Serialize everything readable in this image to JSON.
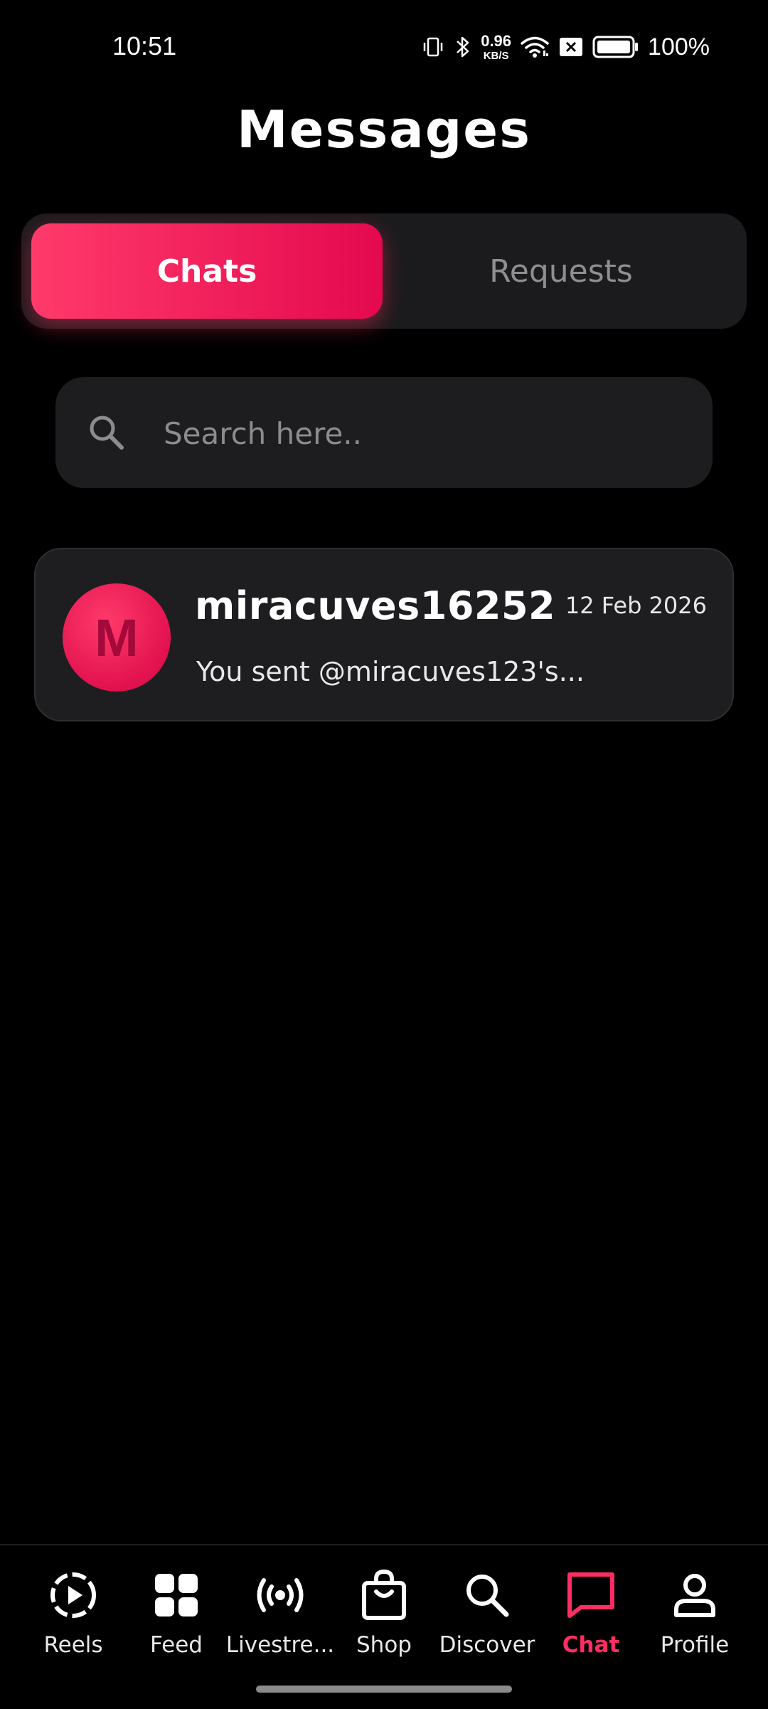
{
  "status_bar": {
    "time": "10:51",
    "net_speed_value": "0.96",
    "net_speed_unit": "KB/S",
    "battery_percent": "100%"
  },
  "header": {
    "title": "Messages"
  },
  "tabs": [
    {
      "label": "Chats",
      "active": true
    },
    {
      "label": "Requests",
      "active": false
    }
  ],
  "search": {
    "placeholder": "Search here.."
  },
  "chats": [
    {
      "avatar_initial": "M",
      "name": "miracuves16252",
      "date": "12 Feb 2026",
      "preview": "You sent @miracuves123's..."
    }
  ],
  "bottom_nav": {
    "items": [
      {
        "label": "Reels",
        "icon": "reels-icon",
        "active": false
      },
      {
        "label": "Feed",
        "icon": "grid-icon",
        "active": false
      },
      {
        "label": "Livestre...",
        "icon": "broadcast-icon",
        "active": false
      },
      {
        "label": "Shop",
        "icon": "shopping-bag-icon",
        "active": false
      },
      {
        "label": "Discover",
        "icon": "search-icon",
        "active": false
      },
      {
        "label": "Chat",
        "icon": "chat-bubble-icon",
        "active": true
      },
      {
        "label": "Profile",
        "icon": "user-icon",
        "active": false
      }
    ]
  },
  "colors": {
    "accent": "#ff2d63",
    "background": "#000000",
    "card": "#1e1e20"
  }
}
